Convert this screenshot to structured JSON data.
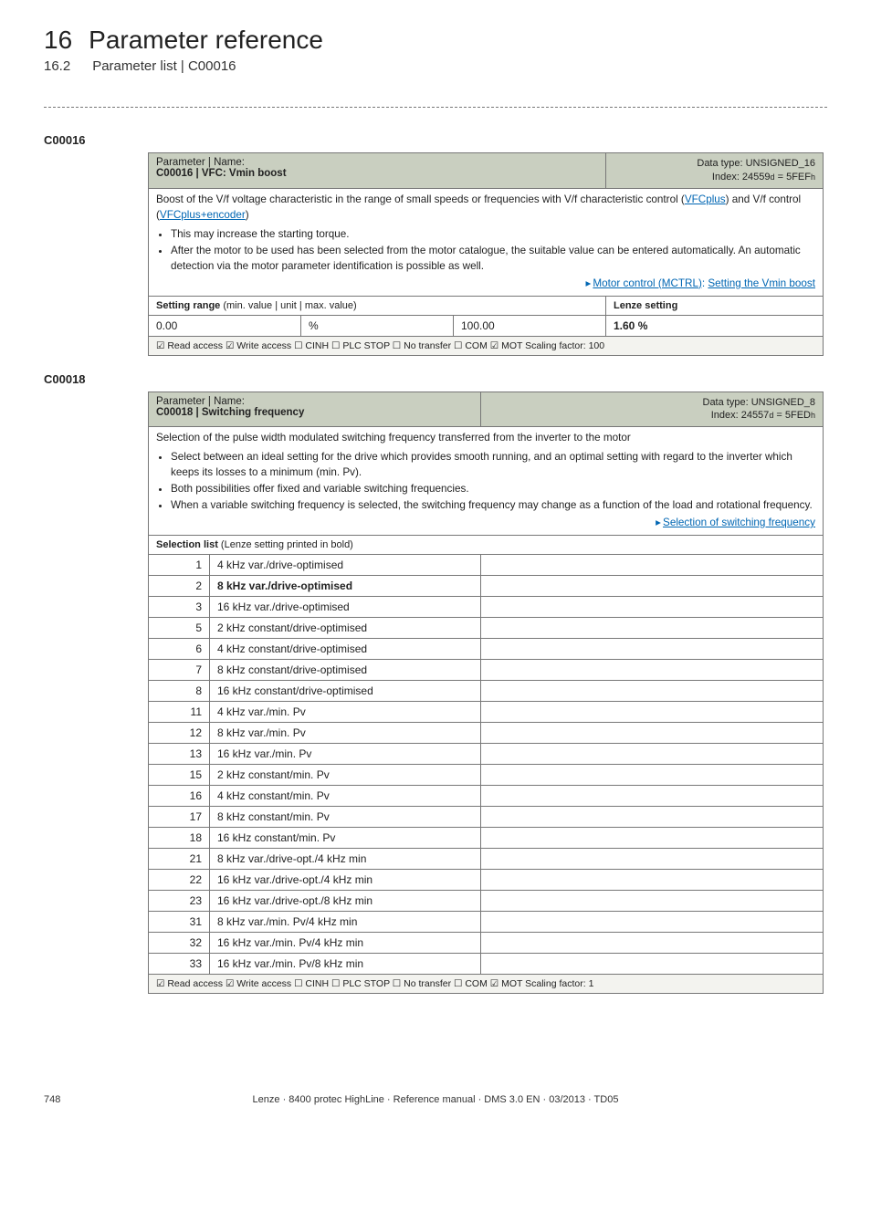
{
  "header": {
    "chapnum": "16",
    "chaptitle": "Parameter reference",
    "secnum": "16.2",
    "sectitle": "Parameter list | C00016"
  },
  "p1": {
    "code": "C00016",
    "pname_label": "Parameter | Name:",
    "pname": "C00016 | VFC: Vmin boost",
    "dtype_l1": "Data type: UNSIGNED_16",
    "dtype_l2_a": "Index: 24559",
    "dtype_l2_b": " = 5FEF",
    "desc_main": "Boost of the V/f voltage characteristic in the range of small speeds or frequencies with V/f characteristic control (",
    "desc_link1": "VFCplus",
    "desc_mid1": ") and V/f control (",
    "desc_link2": "VFCplus+encoder",
    "desc_end1": ")",
    "bul1": "This may increase the starting torque.",
    "bul2": "After the motor to be used has been selected from the motor catalogue, the suitable value can be entered automatically. An automatic detection via the motor parameter identification is possible as well.",
    "rl_pre": "Motor control (MCTRL)",
    "rl_sep": ": ",
    "rl_post": "Setting the Vmin boost",
    "setrange_a": "Setting range ",
    "setrange_b": "(min. value | unit | max. value)",
    "lenze_set": "Lenze setting",
    "min": "0.00",
    "unit": "%",
    "max": "100.00",
    "lenze_val": "1.60 %",
    "footer": "☑ Read access   ☑ Write access   ☐ CINH   ☐ PLC STOP   ☐ No transfer   ☐ COM   ☑ MOT    Scaling factor: 100"
  },
  "p2": {
    "code": "C00018",
    "pname_label": "Parameter | Name:",
    "pname": "C00018 | Switching frequency",
    "dtype_l1": "Data type: UNSIGNED_8",
    "dtype_l2_a": "Index: 24557",
    "dtype_l2_b": " = 5FED",
    "desc_main": "Selection of the pulse width modulated switching frequency transferred from the inverter to the motor",
    "bul1": "Select between an ideal setting for the drive which provides smooth running, and an optimal setting with regard to the inverter which keeps its losses to a minimum (min. Pv).",
    "bul2": "Both possibilities offer fixed and variable switching frequencies.",
    "bul3": "When a variable switching frequency is selected, the switching frequency may change as a function of the load and rotational frequency.",
    "rl": "Selection of switching frequency",
    "selhdr_a": "Selection list ",
    "selhdr_b": "(Lenze setting printed in bold)",
    "rows": [
      {
        "i": "1",
        "t": "4 kHz var./drive-optimised",
        "b": false
      },
      {
        "i": "2",
        "t": "8 kHz var./drive-optimised",
        "b": true
      },
      {
        "i": "3",
        "t": "16 kHz var./drive-optimised",
        "b": false
      },
      {
        "i": "5",
        "t": "2 kHz constant/drive-optimised",
        "b": false
      },
      {
        "i": "6",
        "t": "4 kHz constant/drive-optimised",
        "b": false
      },
      {
        "i": "7",
        "t": "8 kHz constant/drive-optimised",
        "b": false
      },
      {
        "i": "8",
        "t": "16 kHz constant/drive-optimised",
        "b": false
      },
      {
        "i": "11",
        "t": "4 kHz var./min. Pv",
        "b": false
      },
      {
        "i": "12",
        "t": "8 kHz var./min. Pv",
        "b": false
      },
      {
        "i": "13",
        "t": "16 kHz var./min. Pv",
        "b": false
      },
      {
        "i": "15",
        "t": "2 kHz constant/min. Pv",
        "b": false
      },
      {
        "i": "16",
        "t": "4 kHz constant/min. Pv",
        "b": false
      },
      {
        "i": "17",
        "t": "8 kHz constant/min. Pv",
        "b": false
      },
      {
        "i": "18",
        "t": "16 kHz constant/min. Pv",
        "b": false
      },
      {
        "i": "21",
        "t": "8 kHz var./drive-opt./4 kHz min",
        "b": false
      },
      {
        "i": "22",
        "t": "16 kHz var./drive-opt./4 kHz min",
        "b": false
      },
      {
        "i": "23",
        "t": "16 kHz var./drive-opt./8 kHz min",
        "b": false
      },
      {
        "i": "31",
        "t": "8 kHz var./min. Pv/4 kHz min",
        "b": false
      },
      {
        "i": "32",
        "t": "16 kHz var./min. Pv/4 kHz min",
        "b": false
      },
      {
        "i": "33",
        "t": "16 kHz var./min. Pv/8 kHz min",
        "b": false
      }
    ],
    "footer": "☑ Read access   ☑ Write access   ☐ CINH   ☐ PLC STOP   ☐ No transfer   ☐ COM   ☑ MOT    Scaling factor: 1"
  },
  "footer": {
    "page": "748",
    "text": "Lenze · 8400 protec HighLine · Reference manual · DMS 3.0 EN · 03/2013 · TD05"
  },
  "d_sub": "d",
  "h_sub": "h"
}
